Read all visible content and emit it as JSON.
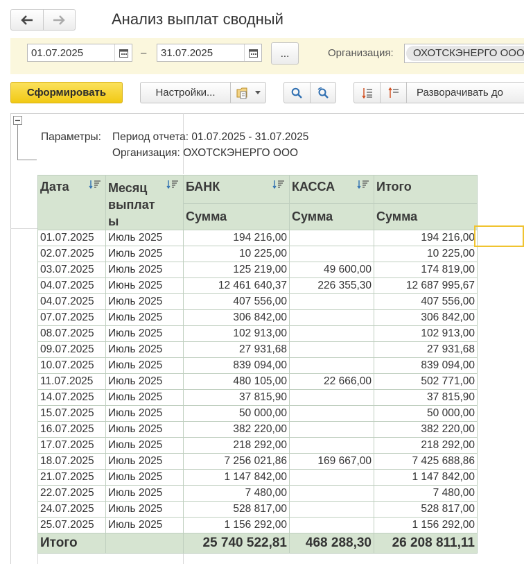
{
  "window": {
    "title": "Анализ выплат сводный"
  },
  "nav": {
    "back_icon": "arrow-left-icon",
    "forward_icon": "arrow-right-icon"
  },
  "params_bar": {
    "date_from": "01.07.2025",
    "separator": "–",
    "date_to": "31.07.2025",
    "period_button": "...",
    "org_label": "Организация:",
    "org_value": "ОХОТСКЭНЕРГО ООО"
  },
  "toolbar": {
    "generate": "Сформировать",
    "settings": "Настройки...",
    "expand_to": "Разворачивать до"
  },
  "report": {
    "params_label": "Параметры:",
    "period_line": "Период отчета: 01.07.2025 - 31.07.2025",
    "org_line": "Организация: ОХОТСКЭНЕРГО ООО",
    "headers": {
      "date": "Дата",
      "month": "Месяц выплат ы",
      "bank": "БАНК",
      "cash": "КАССА",
      "total": "Итого",
      "sum_bank": "Сумма",
      "sum_cash": "Сумма",
      "sum_total": "Сумма"
    },
    "rows": [
      [
        "01.07.2025",
        "Июль 2025",
        "194 216,00",
        "",
        "194 216,00"
      ],
      [
        "02.07.2025",
        "Июль 2025",
        "10 225,00",
        "",
        "10 225,00"
      ],
      [
        "03.07.2025",
        "Июль 2025",
        "125 219,00",
        "49 600,00",
        "174 819,00"
      ],
      [
        "04.07.2025",
        "Июнь 2025",
        "12 461 640,37",
        "226 355,30",
        "12 687 995,67"
      ],
      [
        "04.07.2025",
        "Июль 2025",
        "407 556,00",
        "",
        "407 556,00"
      ],
      [
        "07.07.2025",
        "Июль 2025",
        "306 842,00",
        "",
        "306 842,00"
      ],
      [
        "08.07.2025",
        "Июль 2025",
        "102 913,00",
        "",
        "102 913,00"
      ],
      [
        "09.07.2025",
        "Июль 2025",
        "27 931,68",
        "",
        "27 931,68"
      ],
      [
        "10.07.2025",
        "Июль 2025",
        "839 094,00",
        "",
        "839 094,00"
      ],
      [
        "11.07.2025",
        "Июль 2025",
        "480 105,00",
        "22 666,00",
        "502 771,00"
      ],
      [
        "14.07.2025",
        "Июль 2025",
        "37 815,90",
        "",
        "37 815,90"
      ],
      [
        "15.07.2025",
        "Июль 2025",
        "50 000,00",
        "",
        "50 000,00"
      ],
      [
        "16.07.2025",
        "Июль 2025",
        "382 220,00",
        "",
        "382 220,00"
      ],
      [
        "17.07.2025",
        "Июль 2025",
        "218 292,00",
        "",
        "218 292,00"
      ],
      [
        "18.07.2025",
        "Июль 2025",
        "7 256 021,86",
        "169 667,00",
        "7 425 688,86"
      ],
      [
        "21.07.2025",
        "Июль 2025",
        "1 147 842,00",
        "",
        "1 147 842,00"
      ],
      [
        "22.07.2025",
        "Июль 2025",
        "7 480,00",
        "",
        "7 480,00"
      ],
      [
        "24.07.2025",
        "Июль 2025",
        "528 817,00",
        "",
        "528 817,00"
      ],
      [
        "25.07.2025",
        "Июль 2025",
        "1 156 292,00",
        "",
        "1 156 292,00"
      ]
    ],
    "totals": {
      "label": "Итого",
      "bank": "25 740 522,81",
      "cash": "468 288,30",
      "total": "26 208 811,11"
    }
  },
  "colors": {
    "accent_yellow": "#f1c914",
    "param_bar_bg": "#fbf7dd",
    "header_bg": "#d6e4d1",
    "selection": "#f0c330"
  }
}
